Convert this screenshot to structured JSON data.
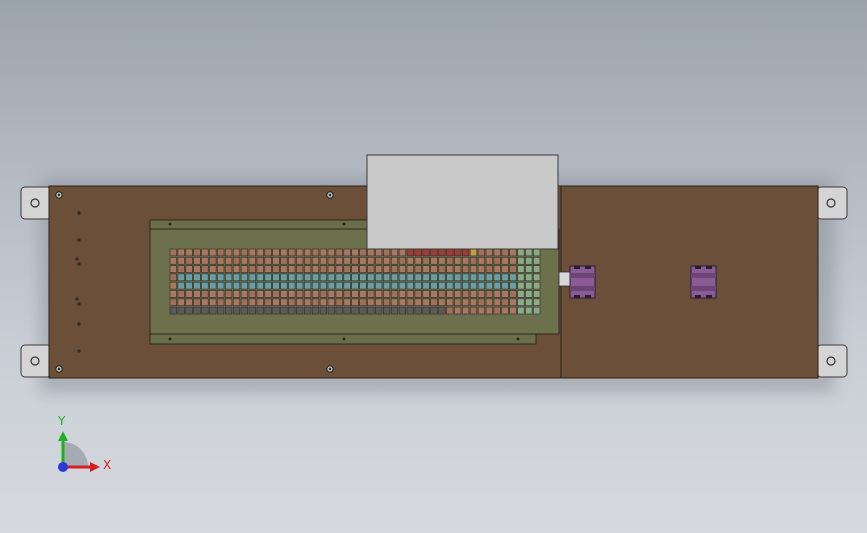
{
  "viewport": {
    "background": "#b5bcc5"
  },
  "model": {
    "plate_color": "#6b4f38",
    "panel_color": "#6b6e4b",
    "cover_color": "#c9c9c9",
    "bracket_color": "#d4d4d4",
    "relay_color": "#8a5b94"
  },
  "triad": {
    "x_label": "X",
    "y_label": "Y",
    "x_color": "#d42020",
    "y_color": "#22b022",
    "z_color": "#2a3ad8"
  }
}
